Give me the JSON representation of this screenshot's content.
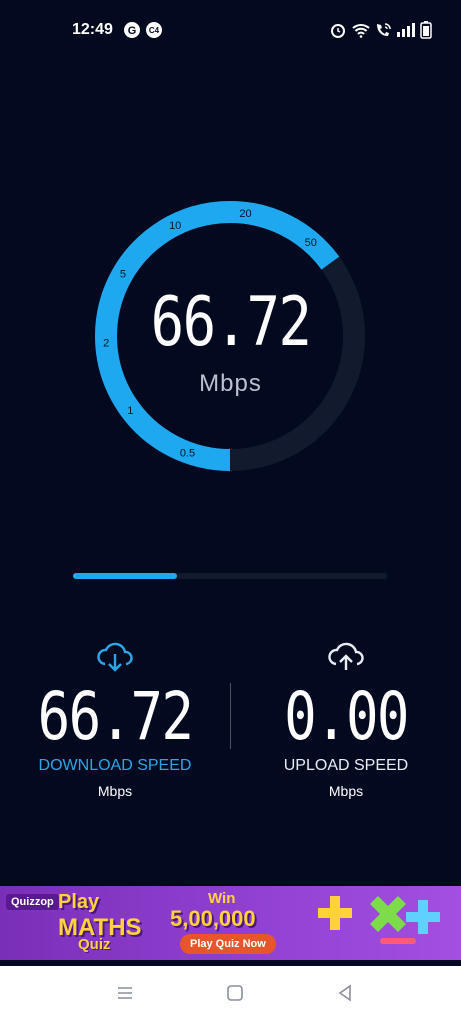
{
  "status_bar": {
    "time": "12:49",
    "left_icons": [
      "google-icon",
      "cast-icon"
    ],
    "right_icons": [
      "alarm-icon",
      "wifi-icon",
      "wifi-call-icon",
      "signal-icon",
      "battery-icon"
    ]
  },
  "gauge": {
    "value": "66.72",
    "unit": "Mbps",
    "scale_labels": [
      "0.5",
      "1",
      "2",
      "5",
      "10",
      "20",
      "50"
    ],
    "fill_fraction": 0.65,
    "accent_color": "#1ea8f0",
    "track_color": "#121a2e"
  },
  "progress": {
    "fraction": 0.33
  },
  "download": {
    "icon": "cloud-download-icon",
    "value": "66.72",
    "label": "DOWNLOAD SPEED",
    "unit": "Mbps",
    "label_color": "#2aa6e8"
  },
  "upload": {
    "icon": "cloud-upload-icon",
    "value": "0.00",
    "label": "UPLOAD SPEED",
    "unit": "Mbps"
  },
  "ad": {
    "brand": "Quizzop",
    "headline_top": "Play",
    "headline_main": "MATHS",
    "headline_sub": "Quiz",
    "win_text": "Win",
    "prize": "5,00,000",
    "cta": "Play Quiz Now"
  },
  "nav": [
    "recents-icon",
    "home-icon",
    "back-icon"
  ]
}
